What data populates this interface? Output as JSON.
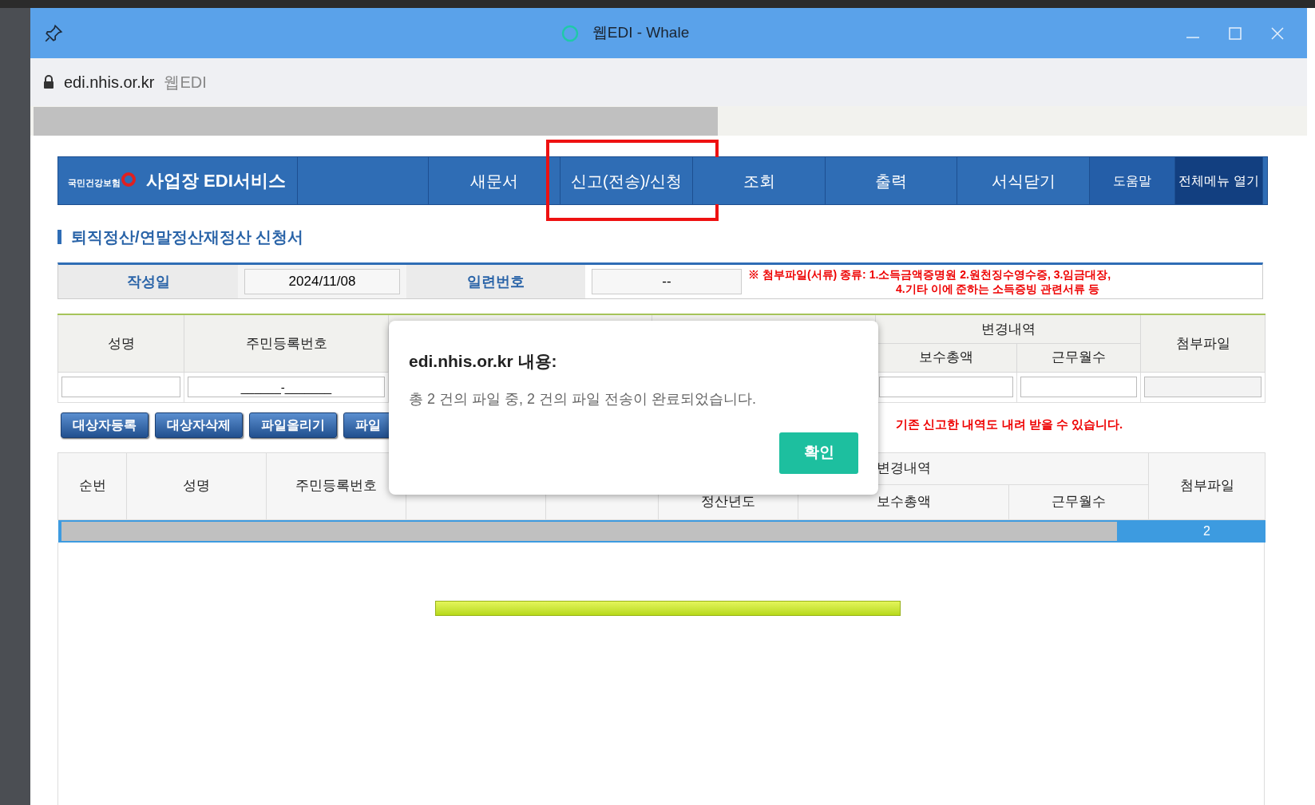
{
  "window": {
    "title": "웹EDI - Whale"
  },
  "address_bar": {
    "domain": "edi.nhis.or.kr",
    "page_title": "웹EDI"
  },
  "nav": {
    "logo_text": "국민건강보험",
    "service_name": "사업장 EDI서비스",
    "items": [
      {
        "label": "새문서",
        "kind": "normal",
        "highlighted": false
      },
      {
        "label": "신고(전송)/신청",
        "kind": "normal",
        "highlighted": true
      },
      {
        "label": "조회",
        "kind": "normal",
        "highlighted": false
      },
      {
        "label": "출력",
        "kind": "normal",
        "highlighted": false
      },
      {
        "label": "서식닫기",
        "kind": "normal",
        "highlighted": false
      },
      {
        "label": "도움말",
        "kind": "help",
        "highlighted": false
      },
      {
        "label": "전체메뉴 열기",
        "kind": "menu",
        "highlighted": false
      }
    ]
  },
  "form_title": "퇴직정산/연말정산재정산 신청서",
  "header_form": {
    "date_label": "작성일",
    "date_value": "2024/11/08",
    "serial_label": "일련번호",
    "serial_value": "--",
    "notice": [
      "※ 첨부파일(서류) 종류: 1.소득금액증명원 2.원천징수영수증, 3.임금대장,",
      "4.기타 이에 준하는 소득증빙 관련서류 등"
    ]
  },
  "entry_table": {
    "name": "성명",
    "rrn": "주민등록번호",
    "change": "변경내역",
    "pay": "보수총액",
    "months": "근무월수",
    "attachment": "첨부파일",
    "rrn_value": "______-_______"
  },
  "buttons": [
    "대상자등록",
    "대상자삭제",
    "파일올리기",
    "파일"
  ],
  "download_note": "기존 신고한 내역도 내려 받을 수 있습니다.",
  "list_table": {
    "no": "순번",
    "name": "성명",
    "rrn": "주민등록번호",
    "change": "변경내역",
    "year": "정산년도",
    "pay": "보수총액",
    "months": "근무월수",
    "attachment": "첨부파일",
    "rows": [
      {
        "attachment": "2",
        "selected": true
      }
    ]
  },
  "progress": {
    "level": 1
  },
  "dialog": {
    "title": "edi.nhis.or.kr 내용:",
    "message": "총 2 건의 파일 중, 2 건의 파일 전송이 완료되었습니다.",
    "button": "확인"
  }
}
